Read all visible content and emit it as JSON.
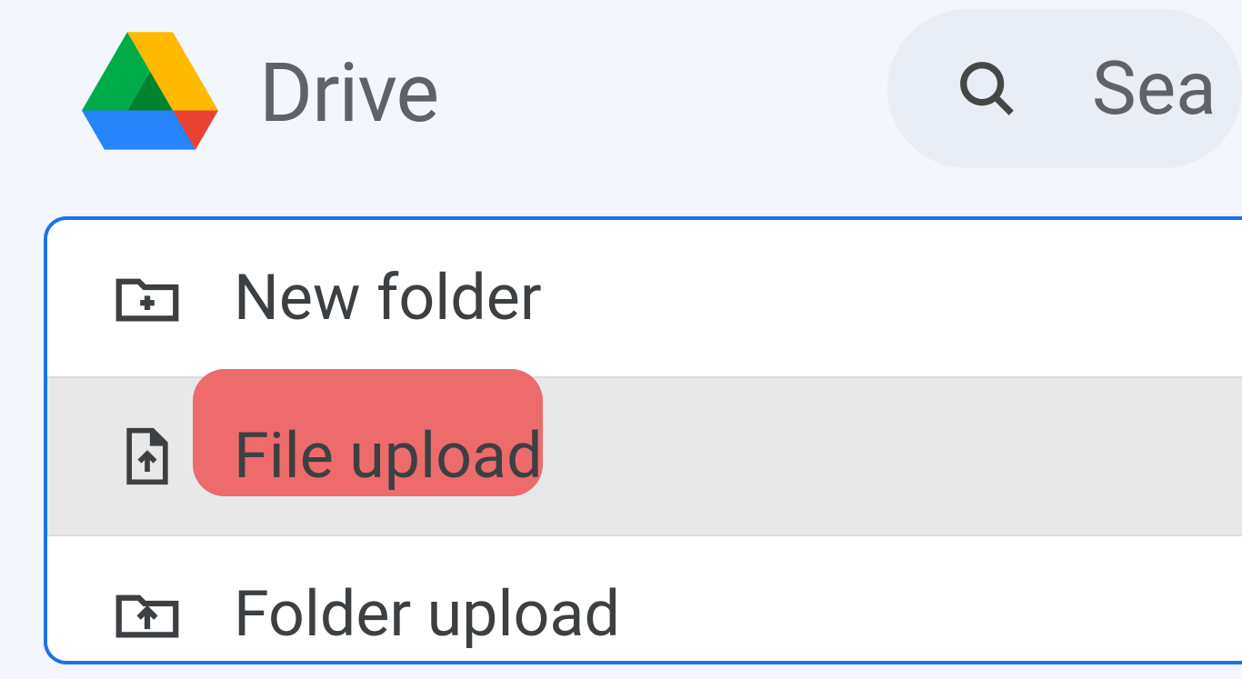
{
  "header": {
    "app_title": "Drive",
    "search_placeholder": "Sea"
  },
  "new_menu": {
    "items": [
      {
        "label": "New folder"
      },
      {
        "label": "File upload"
      },
      {
        "label": "Folder upload"
      }
    ]
  }
}
